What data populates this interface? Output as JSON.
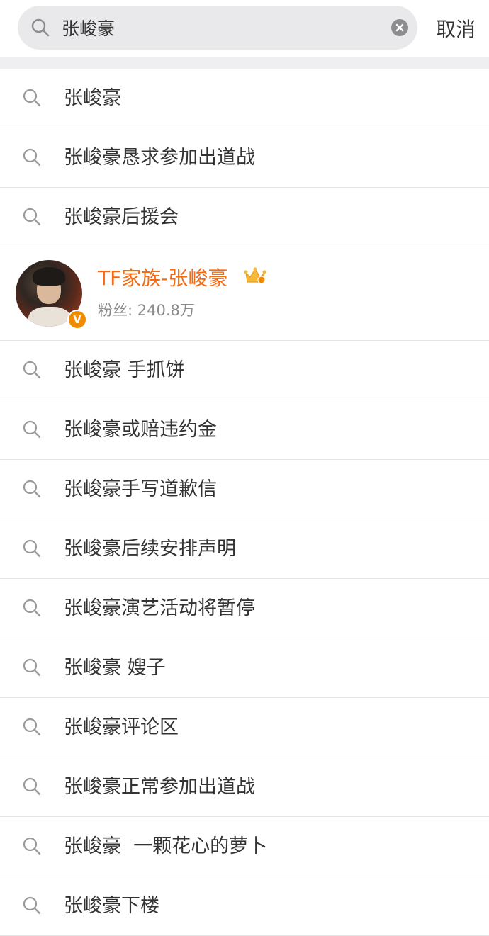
{
  "search": {
    "query": "张峻豪",
    "cancel_label": "取消"
  },
  "suggestions_top": [
    {
      "text": "张峻豪"
    },
    {
      "text": "张峻豪恳求参加出道战"
    },
    {
      "text": "张峻豪后援会"
    }
  ],
  "user_card": {
    "name": "TF家族-张峻豪",
    "fans_label": "粉丝: 240.8万",
    "verified_badge": "V"
  },
  "suggestions_bottom": [
    {
      "text": "张峻豪 手抓饼"
    },
    {
      "text": "张峻豪或赔违约金"
    },
    {
      "text": "张峻豪手写道歉信"
    },
    {
      "text": "张峻豪后续安排声明"
    },
    {
      "text": "张峻豪演艺活动将暂停"
    },
    {
      "text": "张峻豪 嫂子"
    },
    {
      "text": "张峻豪评论区"
    },
    {
      "text": "张峻豪正常参加出道战"
    },
    {
      "text": "张峻豪  一颗花心的萝卜"
    },
    {
      "text": "张峻豪下楼"
    }
  ],
  "colors": {
    "accent_orange": "#f76a11",
    "divider": "#e4e4e4",
    "search_bg": "#e9e9eb"
  }
}
